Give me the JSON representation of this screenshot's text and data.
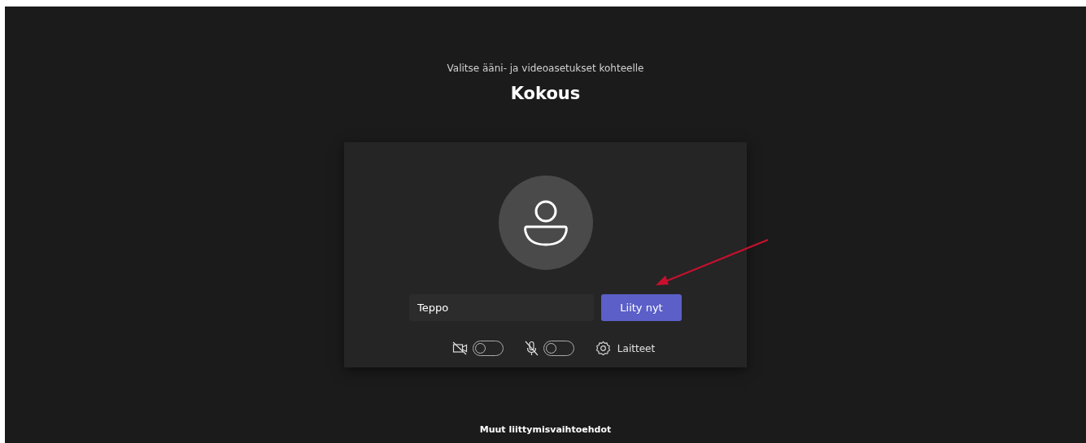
{
  "header": {
    "subtitle": "Valitse ääni- ja videoasetukset kohteelle",
    "title": "Kokous"
  },
  "join": {
    "name_value": "Teppo",
    "join_button": "Liity nyt"
  },
  "controls": [
    {
      "kind": "camera",
      "on": false
    },
    {
      "kind": "mic",
      "on": false
    }
  ],
  "devices_label": "Laitteet",
  "footer_link": "Muut liittymisvaihtoehdot"
}
